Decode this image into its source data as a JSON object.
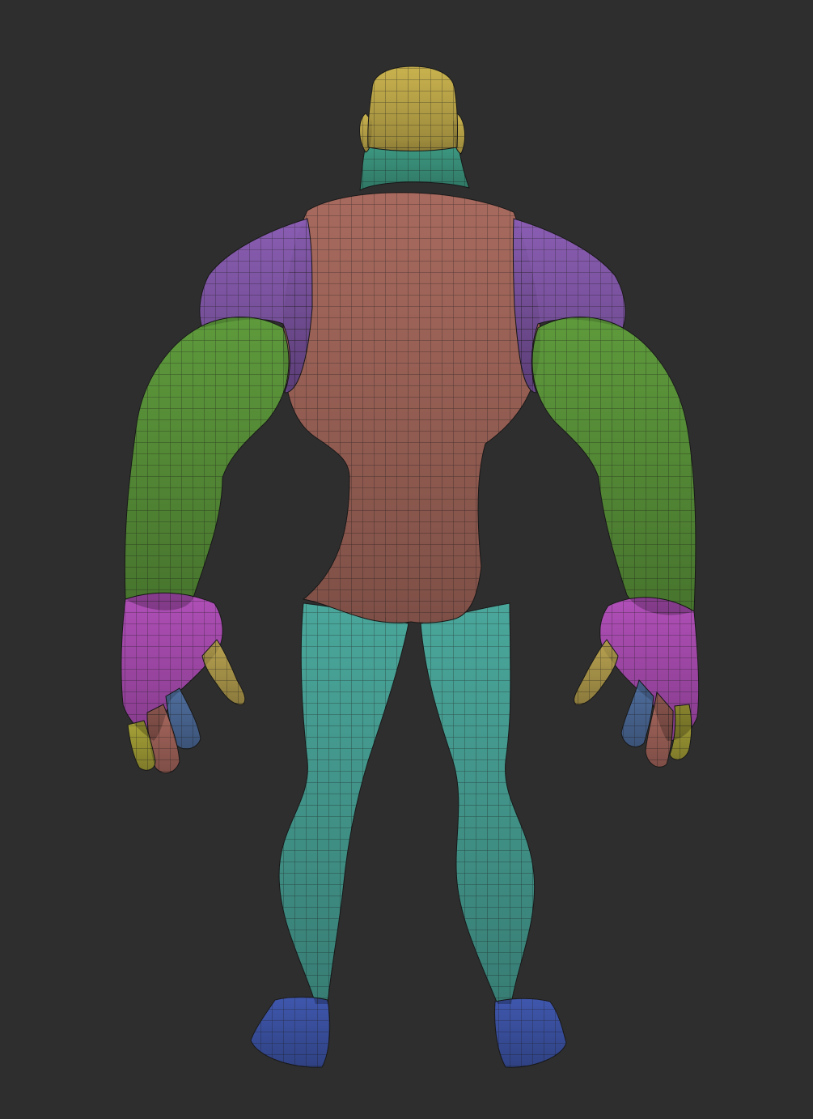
{
  "scene": {
    "background_color": "#2e2e2e",
    "view": "back",
    "polygroups": [
      {
        "id": "head",
        "color": "#c9b24e"
      },
      {
        "id": "neck",
        "color": "#3f9e86"
      },
      {
        "id": "torso",
        "color": "#a86a5e"
      },
      {
        "id": "shoulders",
        "color": "#8a5db3"
      },
      {
        "id": "arms",
        "color": "#5e9a3c"
      },
      {
        "id": "hands",
        "color": "#b04fb8"
      },
      {
        "id": "thumbs",
        "color": "#b8a250"
      },
      {
        "id": "finger-blue",
        "color": "#4f6e9e"
      },
      {
        "id": "finger-red",
        "color": "#a8685e"
      },
      {
        "id": "finger-yellow",
        "color": "#a8a338"
      },
      {
        "id": "legs",
        "color": "#4aa79b"
      },
      {
        "id": "feet",
        "color": "#3f57ad"
      }
    ]
  }
}
